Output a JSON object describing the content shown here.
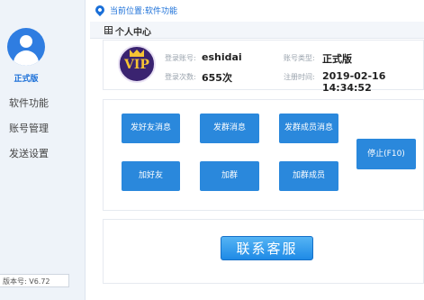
{
  "sidebar": {
    "user_type": "正式版",
    "items": [
      {
        "label": "软件功能"
      },
      {
        "label": "账号管理"
      },
      {
        "label": "发送设置"
      }
    ],
    "version": "版本号: V6.72"
  },
  "breadcrumb": "当前位置:软件功能",
  "section": {
    "title": "个人中心"
  },
  "account": {
    "badge_text": "VIP",
    "login_account_label": "登录账号:",
    "login_account": "eshidai",
    "account_type_label": "账号类型:",
    "account_type": "正式版",
    "login_count_label": "登录次数:",
    "login_count": "655次",
    "register_time_label": "注册时间:",
    "register_time": "2019-02-16 14:34:52"
  },
  "actions": {
    "send_friend_msg": "发好友消息",
    "send_group_msg": "发群消息",
    "send_group_member_msg": "发群成员消息",
    "stop": "停止(F10)",
    "add_friend": "加好友",
    "join_group": "加群",
    "add_group_member": "加群成员"
  },
  "contact": {
    "label": "联系客服"
  },
  "colors": {
    "accent": "#2a88dc",
    "sidebar_bg": "#eef3f9",
    "vip_bg": "#3a2370",
    "vip_gold": "#f6c334"
  },
  "icons": [
    "user-avatar-icon",
    "location-pin-icon",
    "table-icon",
    "crown-icon"
  ]
}
